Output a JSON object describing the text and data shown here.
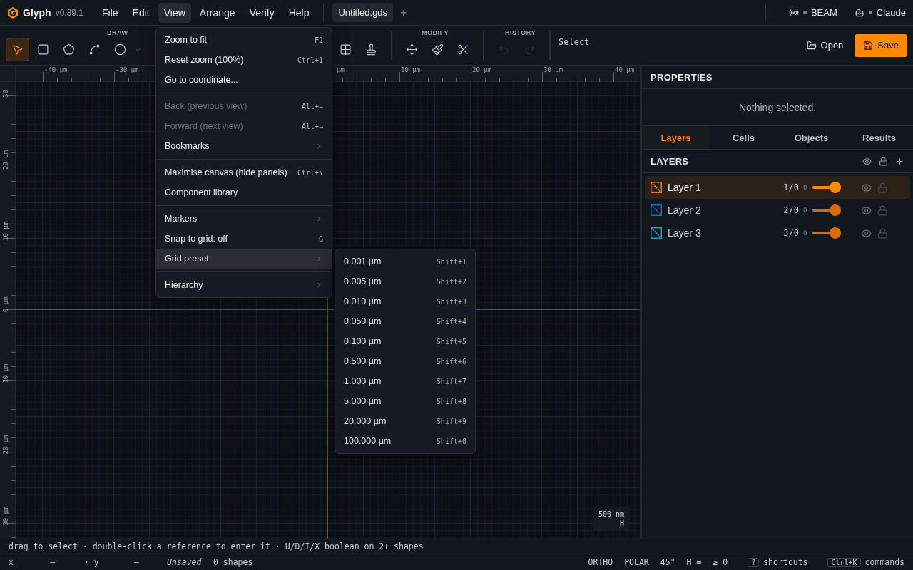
{
  "app": {
    "name": "Glyph",
    "version": "v0.89.1"
  },
  "menubar": [
    {
      "label": "File",
      "selected": false
    },
    {
      "label": "Edit",
      "selected": false
    },
    {
      "label": "View",
      "selected": true
    },
    {
      "label": "Arrange",
      "selected": false
    },
    {
      "label": "Verify",
      "selected": false
    },
    {
      "label": "Help",
      "selected": false
    }
  ],
  "document_tabs": [
    {
      "label": "Untitled.gds",
      "selected": true
    }
  ],
  "new_tab": "+",
  "services": [
    {
      "label": "BEAM",
      "kind": "beam"
    },
    {
      "label": "Claude",
      "kind": "assistant"
    }
  ],
  "toolbar": {
    "groups": [
      {
        "label": "DRAW",
        "tools": [
          {
            "kind": "select",
            "selected": true,
            "disabled": false
          },
          {
            "kind": "rectangle",
            "selected": false,
            "disabled": false
          },
          {
            "kind": "polygon",
            "selected": false,
            "disabled": false
          },
          {
            "kind": "path",
            "selected": false,
            "disabled": false
          },
          {
            "kind": "circle",
            "selected": false,
            "disabled": false
          },
          {
            "kind": "array",
            "selected": false,
            "disabled": false
          },
          {
            "kind": "stamp",
            "selected": false,
            "disabled": false
          }
        ]
      },
      {
        "label": "MODIFY",
        "tools": [
          {
            "kind": "move",
            "selected": false,
            "disabled": false
          },
          {
            "kind": "brush",
            "selected": false,
            "disabled": false
          },
          {
            "kind": "cut",
            "selected": false,
            "disabled": false
          }
        ]
      },
      {
        "label": "HISTORY",
        "tools": [
          {
            "kind": "undo",
            "selected": false,
            "disabled": true
          },
          {
            "kind": "redo",
            "selected": false,
            "disabled": true
          }
        ]
      }
    ],
    "mode": "Select",
    "open": "Open",
    "save": "Save"
  },
  "view_menu": [
    {
      "kind": "item",
      "label": "Zoom to fit",
      "shortcut": "F2",
      "disabled": false,
      "submenu": false,
      "selected": false
    },
    {
      "kind": "item",
      "label": "Reset zoom (100%)",
      "shortcut": "Ctrl+1",
      "disabled": false,
      "submenu": false,
      "selected": false
    },
    {
      "kind": "item",
      "label": "Go to coordinate...",
      "disabled": false,
      "submenu": false,
      "selected": false
    },
    {
      "kind": "separator"
    },
    {
      "kind": "item",
      "label": "Back (previous view)",
      "shortcut": "Alt+←",
      "disabled": true,
      "submenu": false,
      "selected": false
    },
    {
      "kind": "item",
      "label": "Forward (next view)",
      "shortcut": "Alt+→",
      "disabled": true,
      "submenu": false,
      "selected": false
    },
    {
      "kind": "item",
      "label": "Bookmarks",
      "disabled": false,
      "submenu": true,
      "selected": false
    },
    {
      "kind": "separator"
    },
    {
      "kind": "item",
      "label": "Maximise canvas (hide panels)",
      "shortcut": "Ctrl+\\",
      "disabled": false,
      "submenu": false,
      "selected": false
    },
    {
      "kind": "item",
      "label": "Component library",
      "disabled": false,
      "submenu": false,
      "selected": false
    },
    {
      "kind": "separator"
    },
    {
      "kind": "item",
      "label": "Markers",
      "disabled": false,
      "submenu": true,
      "selected": false
    },
    {
      "kind": "item",
      "label": "Snap to grid: off",
      "shortcut": "G",
      "disabled": false,
      "submenu": false,
      "selected": false
    },
    {
      "kind": "item",
      "label": "Grid preset",
      "disabled": false,
      "submenu": true,
      "selected": true
    },
    {
      "kind": "separator"
    },
    {
      "kind": "item",
      "label": "Hierarchy",
      "disabled": false,
      "submenu": true,
      "selected": false
    }
  ],
  "grid_preset_menu": [
    {
      "label": "0.001 µm",
      "shortcut": "Shift+1"
    },
    {
      "label": "0.005 µm",
      "shortcut": "Shift+2"
    },
    {
      "label": "0.010 µm",
      "shortcut": "Shift+3"
    },
    {
      "label": "0.050 µm",
      "shortcut": "Shift+4"
    },
    {
      "label": "0.100 µm",
      "shortcut": "Shift+5"
    },
    {
      "label": "0.500 µm",
      "shortcut": "Shift+6"
    },
    {
      "label": "1.000 µm",
      "shortcut": "Shift+7"
    },
    {
      "label": "5.000 µm",
      "shortcut": "Shift+8"
    },
    {
      "label": "20.000 µm",
      "shortcut": "Shift+9"
    },
    {
      "label": "100.000 µm",
      "shortcut": "Shift+0"
    }
  ],
  "canvas": {
    "x_ruler": [
      "-40 µm",
      "-30 µm",
      "µm",
      "10 µm",
      "20 µm",
      "30 µm",
      "40 µm"
    ],
    "y_ruler": [
      "30",
      "20 µm",
      "10 µm",
      "0 µm",
      "-10 µm",
      "-20 µm",
      "-30 µm"
    ],
    "scale": {
      "value": "500 nm",
      "axis": "H"
    }
  },
  "properties": {
    "title": "PROPERTIES",
    "empty": "Nothing selected."
  },
  "panel_tabs": [
    {
      "label": "Layers",
      "selected": true
    },
    {
      "label": "Cells",
      "selected": false
    },
    {
      "label": "Objects",
      "selected": false
    },
    {
      "label": "Results",
      "selected": false
    }
  ],
  "layers": {
    "title": "LAYERS",
    "items": [
      {
        "name": "Layer 1",
        "spec": "1/0",
        "count": "0",
        "color": "#e8772e",
        "level": 1,
        "selected": true
      },
      {
        "name": "Layer 2",
        "spec": "2/0",
        "count": "0",
        "color": "#1f6e9e",
        "level": 1,
        "selected": false
      },
      {
        "name": "Layer 3",
        "spec": "3/0",
        "count": "0",
        "color": "#2c9bc4",
        "level": 1,
        "selected": false
      }
    ]
  },
  "hint": "drag to select · double-click a reference to enter it · U/D/I/X boolean on 2+ shapes",
  "status_bar": {
    "x_label": "x",
    "x_value": "—",
    "y_label": "· y",
    "y_value": "—",
    "saved_state": "Unsaved",
    "shapes": "0 shapes",
    "toggles": [
      "ORTHO",
      "POLAR",
      "45°",
      "H ∞",
      "≥ 0"
    ],
    "shortcuts": [
      {
        "key": "?",
        "label": "shortcuts"
      },
      {
        "key": "Ctrl+K",
        "label": "commands"
      }
    ]
  }
}
